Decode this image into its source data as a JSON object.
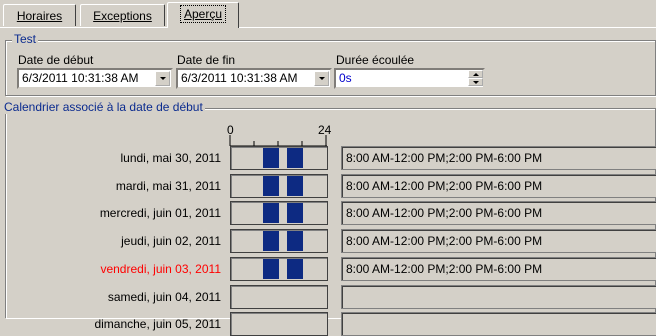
{
  "tabs": {
    "horaires": "Horaires",
    "exceptions": "Exceptions",
    "apercu": "Aperçu"
  },
  "test": {
    "legend": "Test",
    "start_label": "Date de début",
    "start_value": "6/3/2011 10:31:38 AM",
    "end_label": "Date de fin",
    "end_value": "6/3/2011 10:31:38 AM",
    "elapsed_label": "Durée écoulée",
    "elapsed_value": "0s"
  },
  "calendar": {
    "legend": "Calendrier associé à la date de début",
    "scale_start": "0",
    "scale_end": "24",
    "days": [
      {
        "label": "lundi, mai 30, 2011",
        "schedule": "8:00 AM-12:00 PM;2:00 PM-6:00 PM",
        "highlight": false
      },
      {
        "label": "mardi, mai 31, 2011",
        "schedule": "8:00 AM-12:00 PM;2:00 PM-6:00 PM",
        "highlight": false
      },
      {
        "label": "mercredi, juin 01, 2011",
        "schedule": "8:00 AM-12:00 PM;2:00 PM-6:00 PM",
        "highlight": false
      },
      {
        "label": "jeudi, juin 02, 2011",
        "schedule": "8:00 AM-12:00 PM;2:00 PM-6:00 PM",
        "highlight": false
      },
      {
        "label": "vendredi, juin 03, 2011",
        "schedule": "8:00 AM-12:00 PM;2:00 PM-6:00 PM",
        "highlight": true
      },
      {
        "label": "samedi, juin 04, 2011",
        "schedule": "",
        "highlight": false
      },
      {
        "label": "dimanche, juin 05, 2011",
        "schedule": "",
        "highlight": false
      }
    ]
  },
  "colors": {
    "highlight_text": "#ff0000",
    "bar_fill": "#0d2a82",
    "legend_text": "#0b2b8f",
    "elapsed_text": "#0000cc"
  }
}
